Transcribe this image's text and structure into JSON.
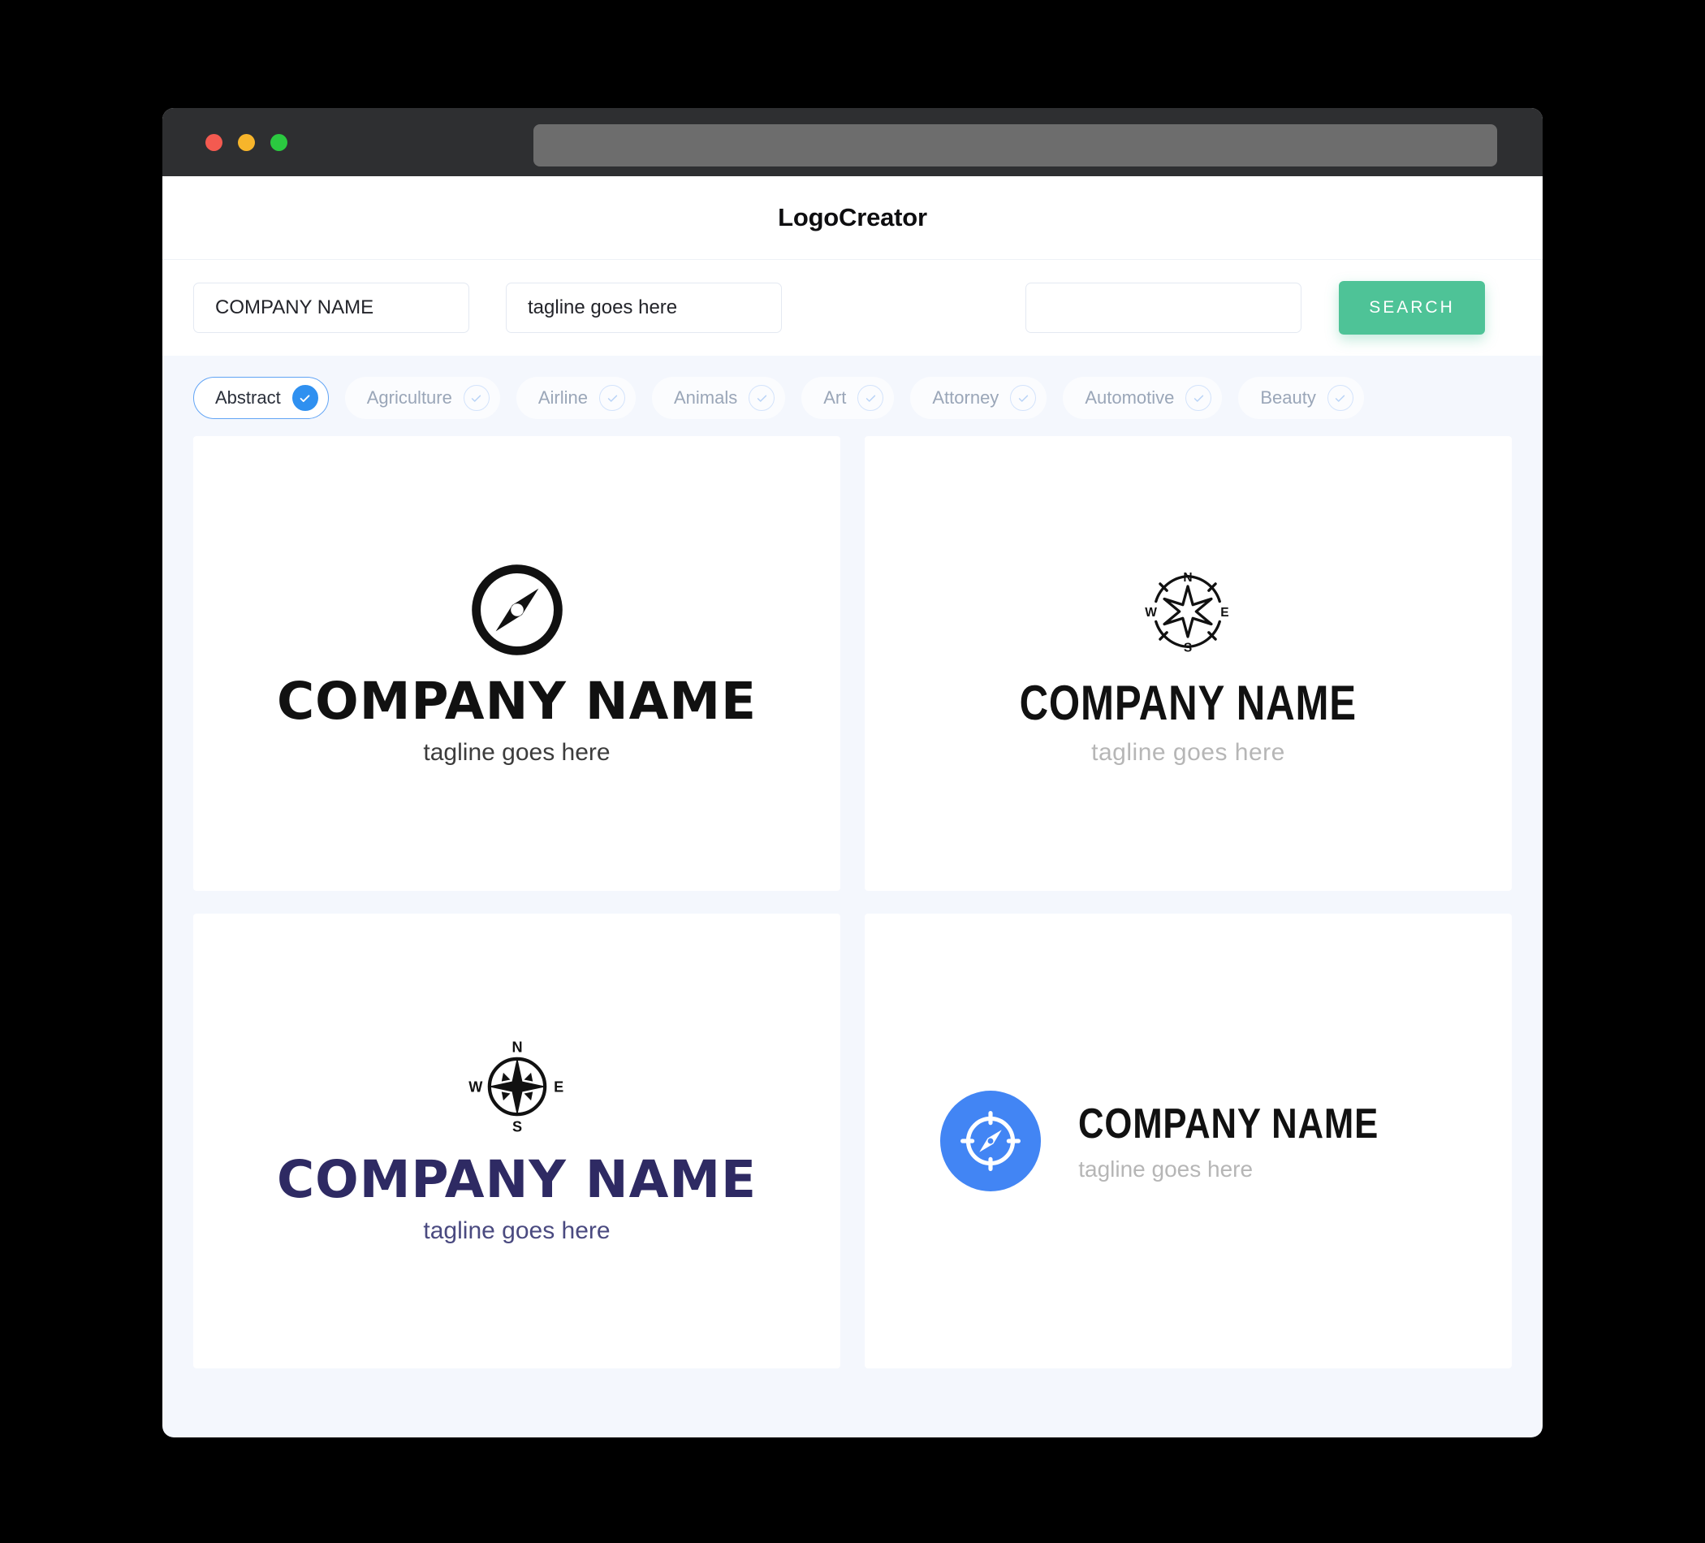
{
  "window": {
    "traffic_lights": [
      "close",
      "minimize",
      "maximize"
    ],
    "url_value": ""
  },
  "header": {
    "title": "LogoCreator"
  },
  "search": {
    "company_value": "COMPANY NAME",
    "tagline_value": "tagline goes here",
    "keyword_value": "",
    "keyword_placeholder": "",
    "search_label": "SEARCH"
  },
  "categories": {
    "next_arrow_icon": "arrow-right-icon",
    "items": [
      {
        "label": "Abstract",
        "selected": true
      },
      {
        "label": "Agriculture",
        "selected": false
      },
      {
        "label": "Airline",
        "selected": false
      },
      {
        "label": "Animals",
        "selected": false
      },
      {
        "label": "Art",
        "selected": false
      },
      {
        "label": "Attorney",
        "selected": false
      },
      {
        "label": "Automotive",
        "selected": false
      },
      {
        "label": "Beauty",
        "selected": false
      }
    ]
  },
  "results": {
    "cards": [
      {
        "icon": "compass-circle-solid-icon",
        "company": "COMPANY NAME",
        "tagline": "tagline goes here",
        "color": "#111111",
        "layout": "stacked"
      },
      {
        "icon": "compass-rose-outline-icon",
        "company": "COMPANY NAME",
        "tagline": "tagline goes here",
        "color": "#111111",
        "layout": "stacked"
      },
      {
        "icon": "compass-star-circle-icon",
        "company": "COMPANY NAME",
        "tagline": "tagline goes here",
        "color": "#2e2a63",
        "layout": "stacked"
      },
      {
        "icon": "compass-blue-badge-icon",
        "company": "COMPANY NAME",
        "tagline": "tagline goes here",
        "color": "#111111",
        "layout": "horizontal",
        "badge_color": "#4285f4"
      }
    ]
  },
  "colors": {
    "accent_green": "#4ec397",
    "accent_blue": "#2f90f0",
    "page_bg": "#f4f7fd",
    "titlebar": "#2e2f31"
  }
}
